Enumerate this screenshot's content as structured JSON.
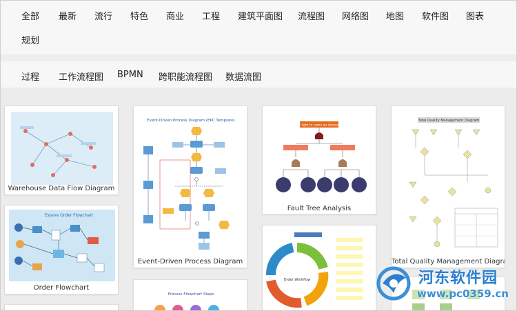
{
  "categories": {
    "row1": [
      "全部",
      "最新",
      "流行",
      "特色",
      "商业",
      "工程",
      "建筑平面图",
      "流程图",
      "网络图",
      "地图",
      "软件图",
      "图表"
    ],
    "row2": [
      "规划"
    ]
  },
  "subcategories": [
    "过程",
    "工作流程图",
    "BPMN",
    "跨职能流程图",
    "数据流图"
  ],
  "templates": [
    {
      "caption": "Warehouse Data Flow Diagram",
      "inner_title": "Data Flow Diagram for the Warehouse Administrations Software"
    },
    {
      "caption": "Order Flowchart",
      "inner_title": "Esteve Order Flowchart"
    },
    {
      "caption": "Event-Driven Process Diagram",
      "inner_title": "Event-Driven Process Diagram (EPC Template)"
    },
    {
      "caption": "Fault Tree Analysis",
      "inner_title": "Fail! light to come on demand !!"
    },
    {
      "caption": "",
      "inner_title": "Order Workflow"
    },
    {
      "caption": "Total Quality Management Diagram",
      "inner_title": "Total Quality Management Diagram"
    },
    {
      "caption": "",
      "inner_title": "Process Flowchart Steps"
    }
  ],
  "watermark": {
    "name": "河东软件园",
    "url": "www.pc0359.cn"
  },
  "colors": {
    "watermark": "#2a7fd0",
    "thumb_blue": "#dff0fa",
    "epc_blue": "#5b9bd5",
    "epc_orange": "#f4b942",
    "fault_red": "#c0504d"
  }
}
